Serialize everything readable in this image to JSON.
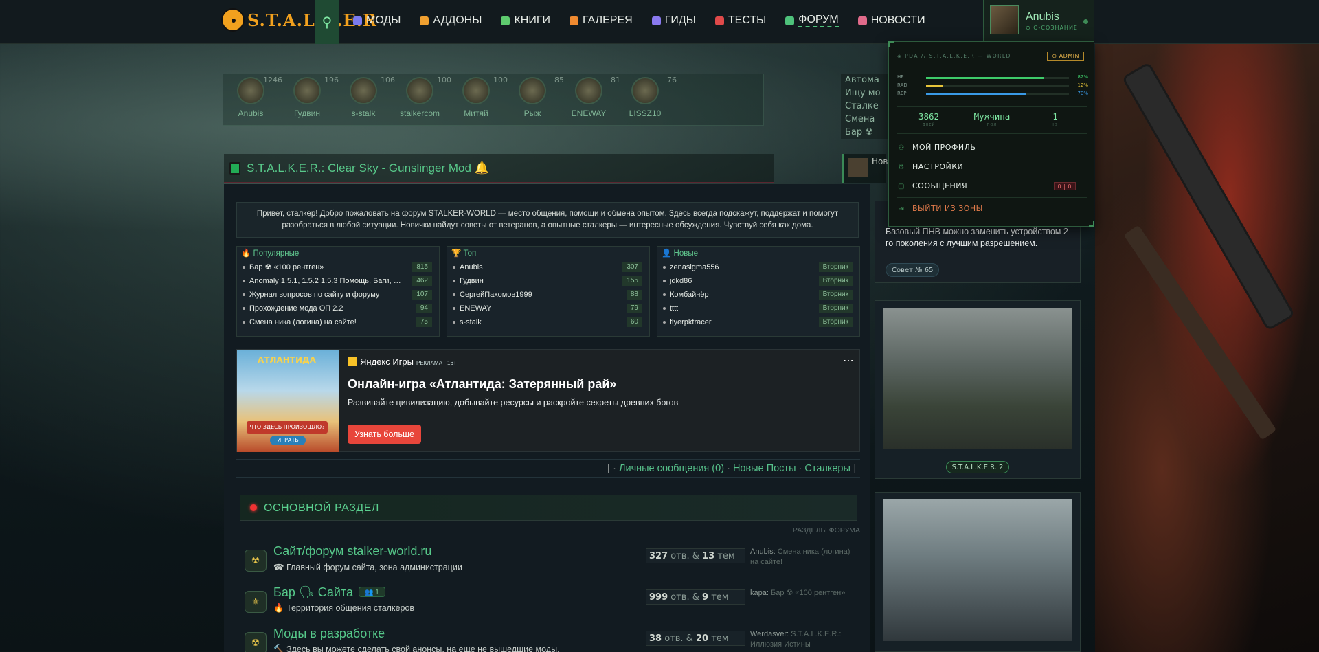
{
  "nav": {
    "logo_text": "S.T.A.L.K.E.R",
    "items": [
      {
        "label": "МОДЫ",
        "color": "#7b7bf0"
      },
      {
        "label": "АДДОНЫ",
        "color": "#f0a030"
      },
      {
        "label": "КНИГИ",
        "color": "#5ecb6e"
      },
      {
        "label": "ГАЛЕРЕЯ",
        "color": "#f08a30"
      },
      {
        "label": "ГИДЫ",
        "color": "#8a7af0"
      },
      {
        "label": "ТЕСТЫ",
        "color": "#e04a4a"
      },
      {
        "label": "ФОРУМ",
        "color": "#4ec27b"
      },
      {
        "label": "НОВОСТИ",
        "color": "#e06a8a"
      }
    ],
    "user": {
      "name": "Anubis",
      "status": "⊙ О-СОЗНАНИЕ"
    }
  },
  "online_users": [
    {
      "name": "Anubis",
      "count": "1246"
    },
    {
      "name": "Гудвин",
      "count": "196"
    },
    {
      "name": "s-stalk",
      "count": "106"
    },
    {
      "name": "stalkercom",
      "count": "100"
    },
    {
      "name": "Митяй",
      "count": "100"
    },
    {
      "name": "Рыж",
      "count": "85"
    },
    {
      "name": "ENEWAY",
      "count": "81"
    },
    {
      "name": "LISSZ10",
      "count": "76"
    }
  ],
  "side_links": [
    "Автома",
    "Ищу мо",
    "Сталке",
    "Смена",
    "Бар ☢"
  ],
  "topic_title": "S.T.A.L.K.E.R.: Clear Sky - Gunslinger Mod",
  "news_label": "Нов",
  "welcome": "Привет, сталкер! Добро пожаловать на форум STALKER-WORLD — место общения, помощи и обмена опытом. Здесь всегда подскажут, поддержат и помогут разобраться в любой ситуации. Новички найдут советы от ветеранов, а опытные сталкеры — интересные обсуждения. Чувствуй себя как дома.",
  "columns": [
    {
      "title": "Популярные",
      "icon": "flame-icon",
      "rows": [
        {
          "text": "Бар ☢ «100 рентген»",
          "badge": "815"
        },
        {
          "text": "Anomaly 1.5.1, 1.5.2 1.5.3 Помощь, Баги, Вылеты",
          "badge": "462"
        },
        {
          "text": "Журнал вопросов по сайту и форуму",
          "badge": "107"
        },
        {
          "text": "Прохождение мода ОП 2.2",
          "badge": "94"
        },
        {
          "text": "Смена ника (логина) на сайте!",
          "badge": "75"
        }
      ]
    },
    {
      "title": "Топ",
      "icon": "trophy-icon",
      "rows": [
        {
          "text": "Anubis",
          "badge": "307"
        },
        {
          "text": "Гудвин",
          "badge": "155"
        },
        {
          "text": "СергейПахомов1999",
          "badge": "88"
        },
        {
          "text": "ENEWAY",
          "badge": "79"
        },
        {
          "text": "s-stalk",
          "badge": "60"
        }
      ]
    },
    {
      "title": "Новые",
      "icon": "user-plus-icon",
      "rows": [
        {
          "text": "zenasigma556",
          "badge": "Вторник"
        },
        {
          "text": "jdkd86",
          "badge": "Вторник"
        },
        {
          "text": "Комбайнёр",
          "badge": "Вторник"
        },
        {
          "text": "tttt",
          "badge": "Вторник"
        },
        {
          "text": "flyerpktracer",
          "badge": "Вторник"
        }
      ]
    }
  ],
  "ad": {
    "image_title": "АТЛАНТИДА",
    "image_caption": "ЧТО ЗДЕСЬ ПРОИЗОШЛО?",
    "image_button": "ИГРАТЬ",
    "brand": "Яндекс Игры",
    "tag": "РЕКЛАМА · 16+",
    "headline": "Онлайн-игра «Атлантида: Затерянный рай»",
    "description": "Развивайте цивилизацию, добывайте ресурсы и раскройте секреты древних богов",
    "button": "Узнать больше"
  },
  "links": {
    "pm": "Личные сообщения (0)",
    "new_posts": "Новые Посты",
    "stalkers": "Сталкеры"
  },
  "section": {
    "title": "ОСНОВНОЙ РАЗДЕЛ",
    "subheading": "РАЗДЕЛЫ ФОРУМА"
  },
  "forums": [
    {
      "title": "Сайт/форум stalker-world.ru",
      "desc": "☎ Главный форум сайта, зона администрации",
      "replies": "327",
      "topics": "13",
      "last_user": "Anubis:",
      "last_text": "Смена ника (логина) на сайте!",
      "badge": ""
    },
    {
      "title": "Бар 🗣 Сайта",
      "desc": "🔥 Территория общения сталкеров",
      "replies": "999",
      "topics": "9",
      "last_user": "kapa:",
      "last_text": "Бар ☢ «100 рентген»",
      "badge": "👥 1"
    },
    {
      "title": "Моды в разработке",
      "desc": "🔨 Здесь вы можете сделать свой анонсы, на еще не вышедшие моды.",
      "replies": "38",
      "topics": "20",
      "last_user": "Werdasver:",
      "last_text": "S.T.A.L.K.E.R.: Иллюзия Истины",
      "badge": ""
    }
  ],
  "stat_labels": {
    "replies": "отв.",
    "and": "&",
    "topics": "тем"
  },
  "tip": {
    "text": "Базовый ПНВ можно заменить устройством 2-го поколения с лучшим разрешением.",
    "badge": "Совет № 65"
  },
  "gallery": [
    {
      "caption": "S.T.A.L.K.E.R. 2"
    },
    {
      "caption": ""
    }
  ],
  "pda": {
    "header": "◈ PDA // S.T.A.L.K.E.R — WORLD",
    "admin": "⊙ ADMIN",
    "bars": [
      {
        "label": "HP",
        "value": "82%",
        "fraction": 0.82,
        "color": "#3ecb6a"
      },
      {
        "label": "RAD",
        "value": "12%",
        "fraction": 0.12,
        "color": "#e6c43a"
      },
      {
        "label": "REP",
        "value": "70%",
        "fraction": 0.7,
        "color": "#3a9ae6"
      }
    ],
    "stats": [
      {
        "value": "3862",
        "label": "ДНЕЙ"
      },
      {
        "value": "Мужчина",
        "label": "ПОЛ"
      },
      {
        "value": "1",
        "label": "ID"
      }
    ],
    "menu": {
      "profile": "МОЙ ПРОФИЛЬ",
      "settings": "НАСТРОЙКИ",
      "messages": "СООБЩЕНИЯ",
      "messages_count": "0 | 0",
      "logout": "ВЫЙТИ ИЗ ЗОНЫ"
    }
  }
}
